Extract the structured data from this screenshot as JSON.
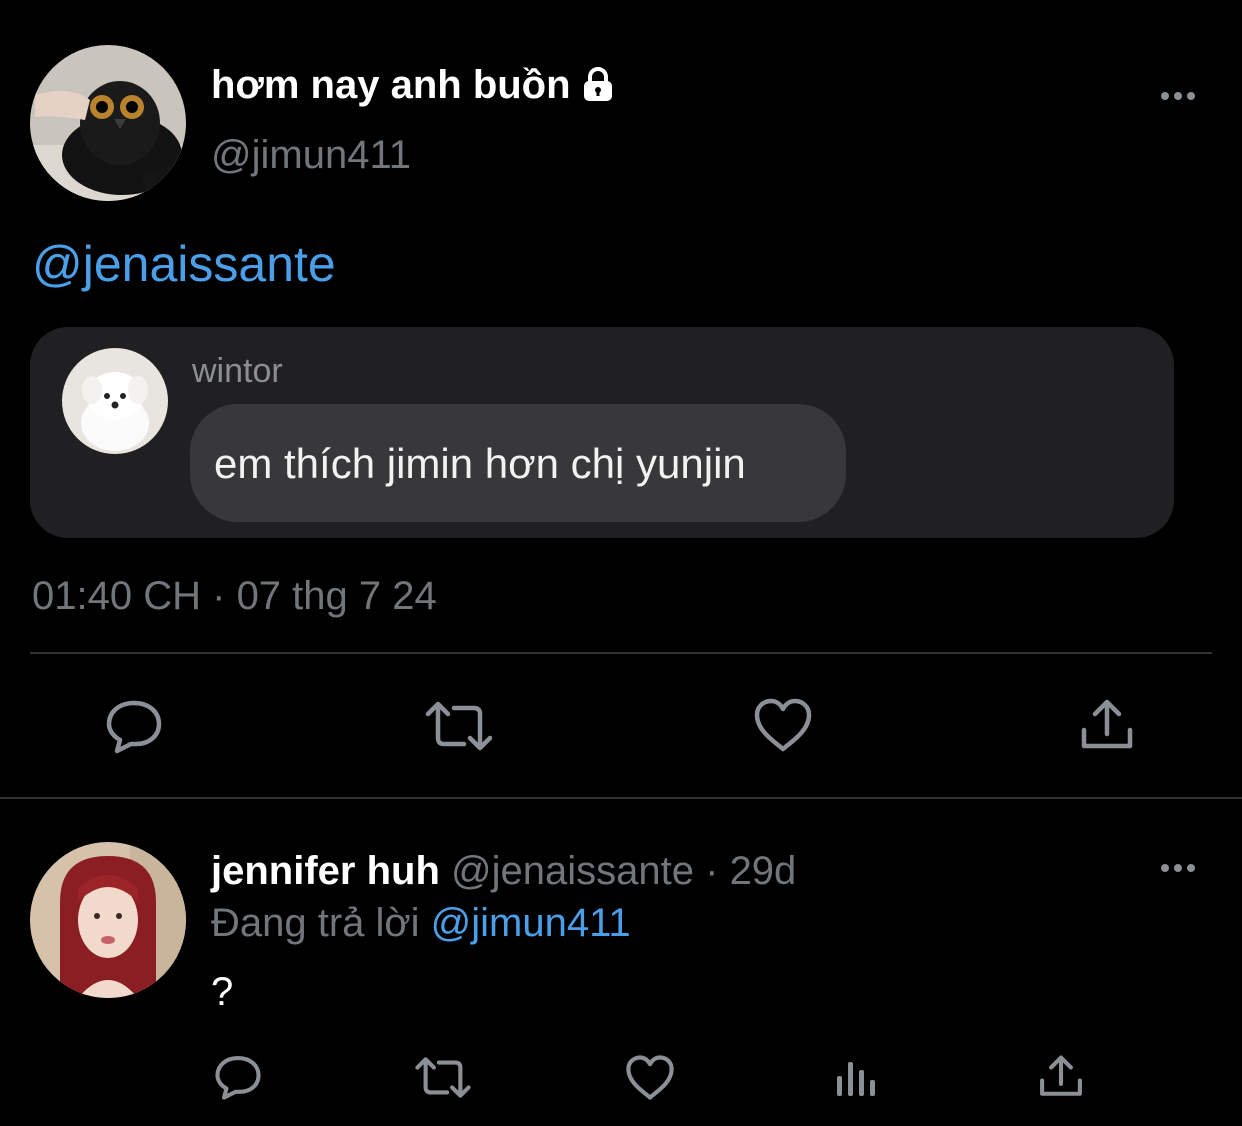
{
  "main_tweet": {
    "display_name": "hơm nay anh buồn",
    "handle": "@jimun411",
    "mention": "@jenaissante",
    "timestamp": "01:40 CH",
    "separator": "·",
    "date": "07 thg 7 24",
    "avatar_desc": "dark wet owl-like pet photo",
    "lock_icon": "lock-icon",
    "more_icon": "more-horizontal-icon"
  },
  "quoted_message": {
    "sender": "wintor",
    "text": "em thích jimin hơn chị yunjin",
    "avatar_desc": "white fluffy puppy"
  },
  "main_actions": [
    {
      "name": "reply",
      "icon": "reply-icon"
    },
    {
      "name": "retweet",
      "icon": "retweet-icon"
    },
    {
      "name": "like",
      "icon": "heart-icon"
    },
    {
      "name": "share",
      "icon": "share-icon"
    }
  ],
  "reply_tweet": {
    "display_name": "jennifer huh",
    "handle": "@jenaissante",
    "separator": "·",
    "age": "29d",
    "replying_to_label": "Đang trả lời",
    "replying_to_handle": "@jimun411",
    "text": "?",
    "avatar_desc": "person with long red hair",
    "more_icon": "more-horizontal-icon"
  },
  "reply_actions": [
    {
      "name": "reply",
      "icon": "reply-icon"
    },
    {
      "name": "retweet",
      "icon": "retweet-icon"
    },
    {
      "name": "like",
      "icon": "heart-icon"
    },
    {
      "name": "views",
      "icon": "views-icon"
    },
    {
      "name": "share",
      "icon": "share-icon"
    }
  ],
  "colors": {
    "background": "#000000",
    "accent_blue": "#4a9fe8",
    "muted_gray": "#71767b",
    "quote_bg": "#202022",
    "bubble_bg": "#38383a"
  }
}
